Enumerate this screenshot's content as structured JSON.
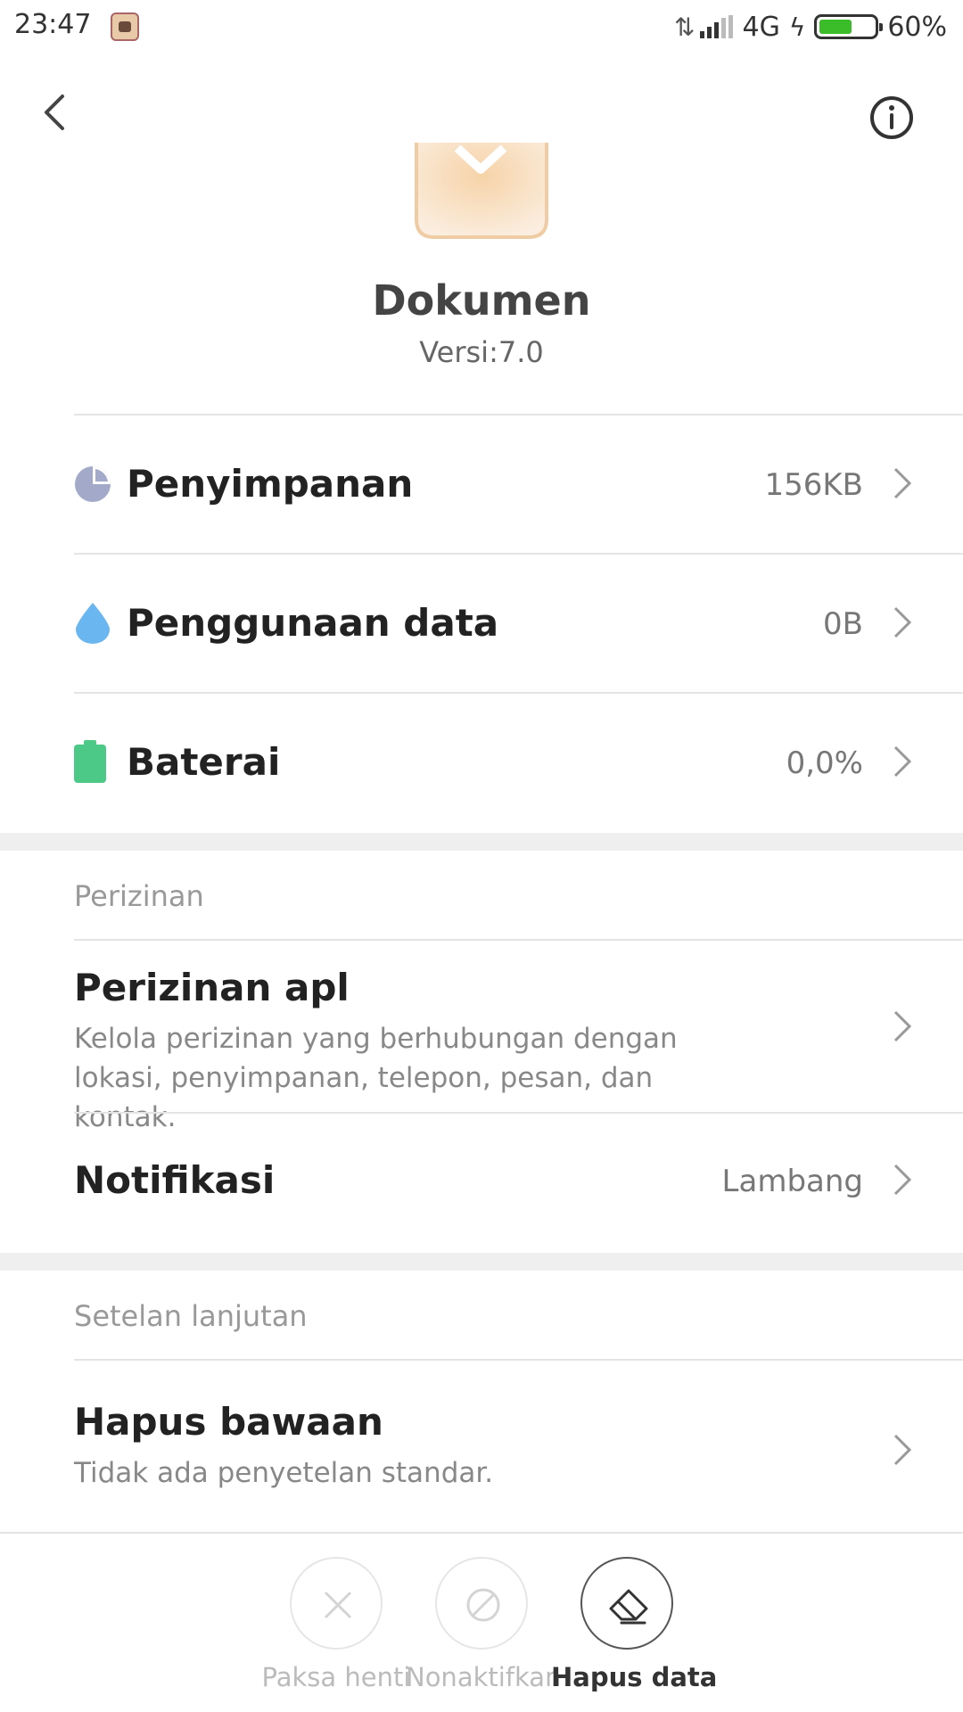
{
  "status_bar": {
    "time": "23:47",
    "network": "4G",
    "battery_percent": "60%",
    "battery_level": 0.6,
    "notification_icon": "game-app-icon"
  },
  "header": {
    "back_icon": "back-arrow-icon",
    "info_icon": "info-icon"
  },
  "app": {
    "name": "Dokumen",
    "version": "Versi:7.0",
    "icon": "document-app-icon"
  },
  "usage_rows": [
    {
      "label": "Penyimpanan",
      "value": "156KB",
      "icon": "pie-chart-icon",
      "color": "#a3aac9"
    },
    {
      "label": "Penggunaan data",
      "value": "0B",
      "icon": "water-drop-icon",
      "color": "#6ab6f0"
    },
    {
      "label": "Baterai",
      "value": "0,0%",
      "icon": "battery-icon",
      "color": "#4cc987"
    }
  ],
  "permissions": {
    "section_title": "Perizinan",
    "app_permissions_title": "Perizinan apl",
    "app_permissions_desc": "Kelola perizinan yang berhubungan dengan lokasi, penyimpanan, telepon, pesan, dan kontak.",
    "notifications_title": "Notifikasi",
    "notifications_value": "Lambang"
  },
  "advanced": {
    "section_title": "Setelan lanjutan",
    "clear_defaults_title": "Hapus bawaan",
    "clear_defaults_desc": "Tidak ada penyetelan standar."
  },
  "actions": [
    {
      "label": "Paksa henti",
      "icon": "close-icon",
      "enabled": false
    },
    {
      "label": "Nonaktifkan",
      "icon": "disable-icon",
      "enabled": false
    },
    {
      "label": "Hapus data",
      "icon": "eraser-icon",
      "enabled": true
    }
  ]
}
